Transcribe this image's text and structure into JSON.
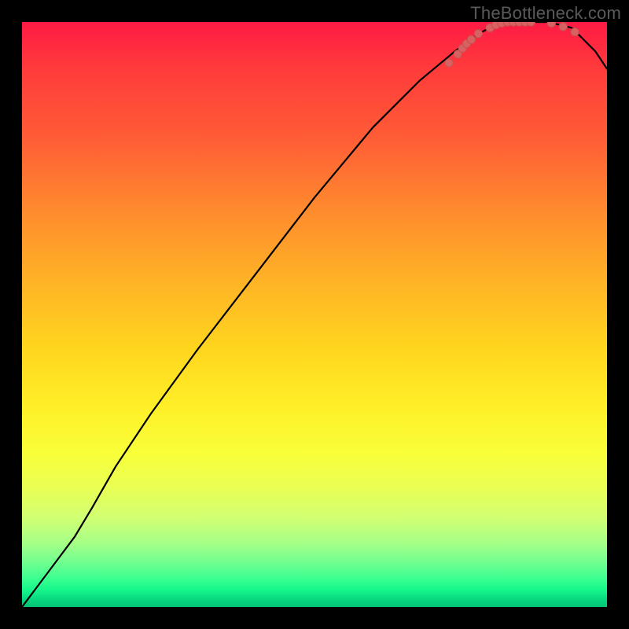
{
  "watermark": "TheBottleneck.com",
  "colors": {
    "background": "#000000",
    "curve": "#000000",
    "marker_fill": "#d86262",
    "marker_stroke": "#c74f4f"
  },
  "chart_data": {
    "type": "line",
    "title": "",
    "xlabel": "",
    "ylabel": "",
    "xlim": [
      0,
      100
    ],
    "ylim": [
      0,
      100
    ],
    "curve": {
      "x": [
        0,
        3,
        6,
        9,
        12,
        16,
        22,
        30,
        40,
        50,
        60,
        68,
        74,
        78,
        82,
        86,
        90,
        94,
        98,
        100
      ],
      "y": [
        0,
        4,
        8,
        12,
        17,
        24,
        33,
        44,
        57,
        70,
        82,
        90,
        95,
        98,
        100,
        100,
        100,
        99,
        95,
        92
      ]
    },
    "markers": {
      "x": [
        73,
        74.5,
        75.3,
        76,
        76.8,
        78,
        80,
        81,
        82,
        83,
        84,
        85,
        86,
        87,
        90.5,
        92.5,
        94.5
      ],
      "y": [
        93,
        94.5,
        95.5,
        96.3,
        97,
        98,
        99,
        99.5,
        99.8,
        100,
        100,
        100,
        100,
        100,
        99.8,
        99.2,
        98.3
      ]
    }
  }
}
